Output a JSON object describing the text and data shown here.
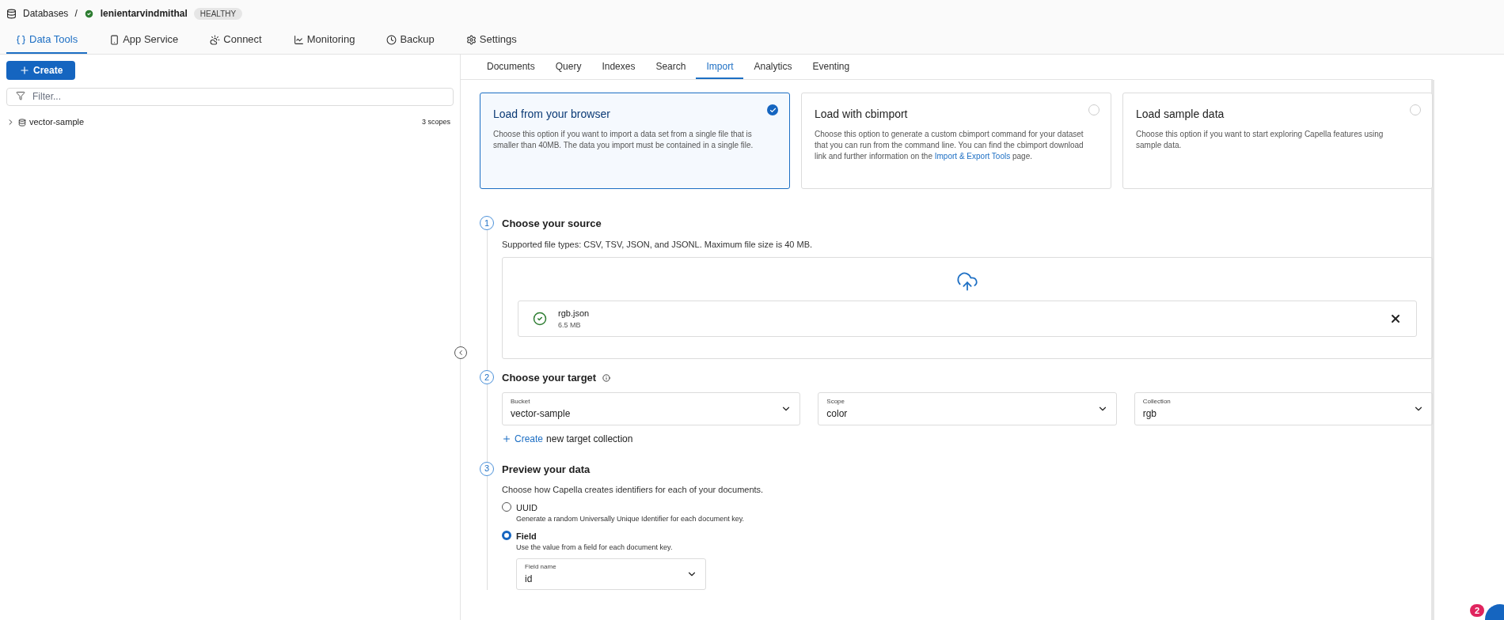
{
  "breadcrumb": {
    "root": "Databases",
    "separator": "/",
    "cluster": "lenientarvindmithal",
    "status": "HEALTHY"
  },
  "nav_tabs": [
    {
      "label": "Data Tools",
      "selected": true
    },
    {
      "label": "App Service",
      "selected": false
    },
    {
      "label": "Connect",
      "selected": false
    },
    {
      "label": "Monitoring",
      "selected": false
    },
    {
      "label": "Backup",
      "selected": false
    },
    {
      "label": "Settings",
      "selected": false
    }
  ],
  "sidebar": {
    "create_button": "Create",
    "filter": {
      "placeholder": "Filter..."
    },
    "items": [
      {
        "name": "vector-sample",
        "count": "3 scopes",
        "expanded": false
      }
    ]
  },
  "sub_tabs": [
    {
      "label": "Documents",
      "selected": false
    },
    {
      "label": "Query",
      "selected": false
    },
    {
      "label": "Indexes",
      "selected": false
    },
    {
      "label": "Search",
      "selected": false
    },
    {
      "label": "Import",
      "selected": true
    },
    {
      "label": "Analytics",
      "selected": false
    },
    {
      "label": "Eventing",
      "selected": false
    }
  ],
  "options": [
    {
      "title": "Load from your browser",
      "text": "Choose this option if you want to import a data set from a single file that is smaller than 40MB. The data you import must be contained in a single file.",
      "selected": true
    },
    {
      "title": "Load with cbimport",
      "text": "Choose this option to generate a custom cbimport command for your dataset that you can run from the command line. You can find the cbimport download link and further information on the",
      "link": "Import & Export Tools",
      "after": "page.",
      "selected": false
    },
    {
      "title": "Load sample data",
      "text": "Choose this option if you want to start exploring Capella features using sample data.",
      "selected": false
    }
  ],
  "source": {
    "step": "1",
    "title": "Choose your source",
    "text": "Supported file types: CSV, TSV, JSON, and JSONL. Maximum file size is 40 MB.",
    "file": {
      "name": "rgb.json",
      "size": "6.5 MB"
    }
  },
  "target": {
    "step": "2",
    "title": "Choose your target",
    "selects": [
      {
        "label": "Bucket",
        "value": "vector-sample"
      },
      {
        "label": "Scope",
        "value": "color"
      },
      {
        "label": "Collection",
        "value": "rgb"
      }
    ],
    "create_link": "Create",
    "create_text": "new target collection"
  },
  "preview": {
    "step": "3",
    "title": "Preview your data",
    "text": "Choose how Capella creates identifiers for each of your documents.",
    "radios": [
      {
        "label": "UUID",
        "text": "Generate a random Universally Unique Identifier for each document key.",
        "selected": false
      },
      {
        "label": "Field",
        "text": "Use the value from a field for each document key.",
        "selected": true
      }
    ],
    "field": {
      "label": "Field name",
      "value": "id"
    }
  },
  "help": {
    "badge": "2"
  }
}
